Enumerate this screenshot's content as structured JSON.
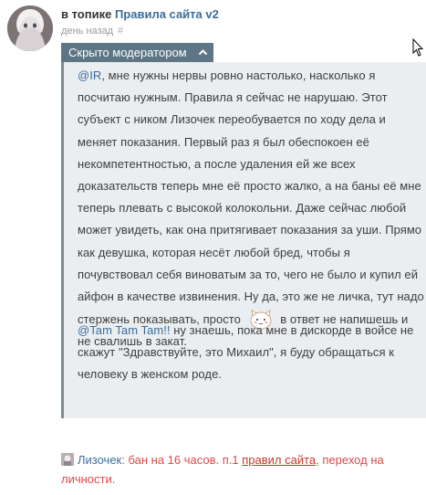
{
  "post": {
    "prefix": "в топике",
    "topic": "Правила сайта v2",
    "time": "день назад",
    "hash": "#"
  },
  "spoiler": {
    "label": "Скрыто модератором"
  },
  "paragraph1": {
    "mention": "@IR",
    "text_a": ", мне нужны нервы ровно настолько, насколько я посчитаю нужным. Правила я сейчас не нарушаю. Этот субъект с ником Лизочек переобувается по ходу дела и меняет показания. Первый раз я был обеспокоен её некомпетентностью, а после удаления ей же всех доказательств теперь мне её просто жалко, а на баны её мне теперь плевать с высокой колокольни. Даже сейчас любой может увидеть, как она притягивает показания за уши. Прямо как девушка, которая несёт любой бред, чтобы я почувствовал себя виноватым за то, чего не было и купил ей айфон в качестве извинения. Ну да, это же не личка, тут надо стержень показывать, просто",
    "text_b": "в ответ не напишешь и не свалишь в закат."
  },
  "paragraph2": {
    "mention": "@Tam Tam Tam!!",
    "text": " ну знаешь, пока мне в дискорде в войсе не скажут \"Здравствуйте, это Михаил\", я буду обращаться к человеку в женском роде."
  },
  "ban": {
    "who": "Лизочек",
    "text_a": ": бан на 16 часов. п.1 ",
    "link": "правил сайта",
    "text_b": ", переход на личности."
  }
}
